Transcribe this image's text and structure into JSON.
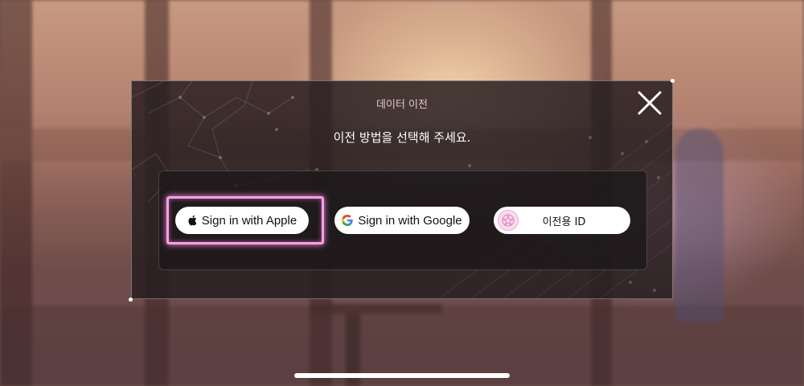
{
  "dialog": {
    "title": "데이터 이전",
    "subtitle": "이전 방법을 선택해 주세요."
  },
  "buttons": {
    "apple_label": "Sign in with Apple",
    "google_label": "Sign in with Google",
    "migration_id_label": "이전용 ID"
  },
  "colors": {
    "highlight": "#f59fe6",
    "dialog_bg": "#261e20",
    "title_text": "#e3c4c4"
  },
  "icons": {
    "close": "close-icon",
    "apple": "apple-logo-icon",
    "google": "google-logo-icon",
    "migration": "migration-id-logo-icon"
  }
}
